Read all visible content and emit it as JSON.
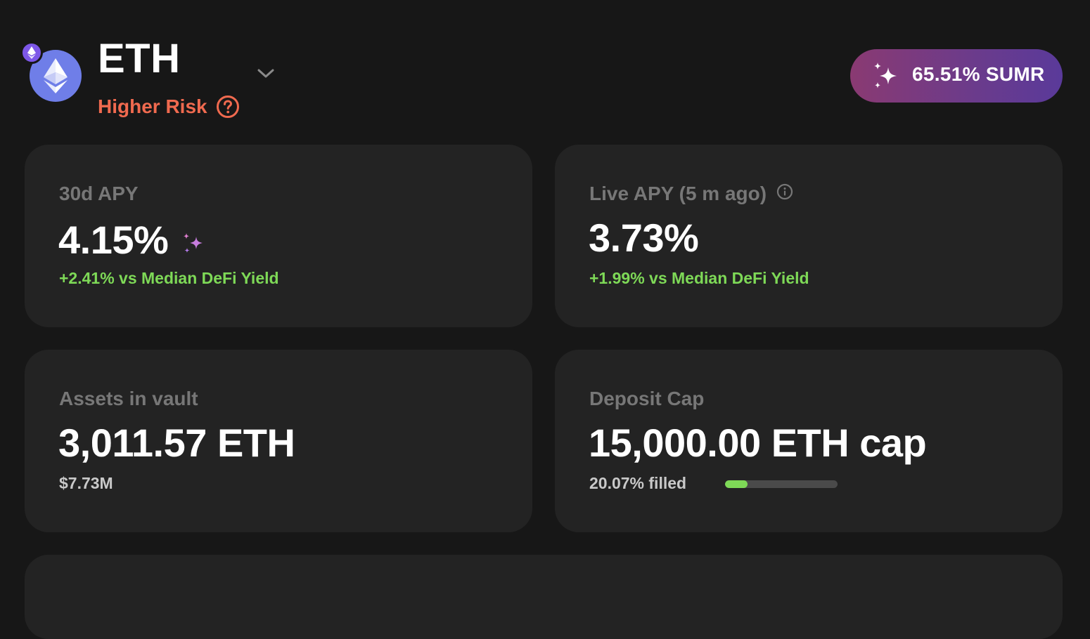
{
  "header": {
    "token_symbol": "ETH",
    "risk_label": "Higher Risk",
    "token_icon": "ethereum-icon",
    "network_icon": "ethereum-network-icon",
    "sumr_label": "65.51% SUMR"
  },
  "colors": {
    "background": "#171717",
    "card": "#232323",
    "risk": "#f06a4f",
    "positive": "#7ed957",
    "token_icon_bg": "#6f7ee8",
    "sumr_gradient_start": "#8a3a72",
    "sumr_gradient_end": "#5a3a9a"
  },
  "cards": {
    "apy_30d": {
      "label": "30d APY",
      "value": "4.15%",
      "comparison": "+2.41% vs Median DeFi Yield"
    },
    "live_apy": {
      "label": "Live APY (5 m ago)",
      "value": "3.73%",
      "comparison": "+1.99% vs Median DeFi Yield"
    },
    "assets": {
      "label": "Assets in vault",
      "value": "3,011.57 ETH",
      "usd_value": "$7.73M"
    },
    "deposit_cap": {
      "label": "Deposit Cap",
      "value": "15,000.00 ETH cap",
      "filled_text": "20.07% filled",
      "filled_percent": 20.07
    }
  }
}
